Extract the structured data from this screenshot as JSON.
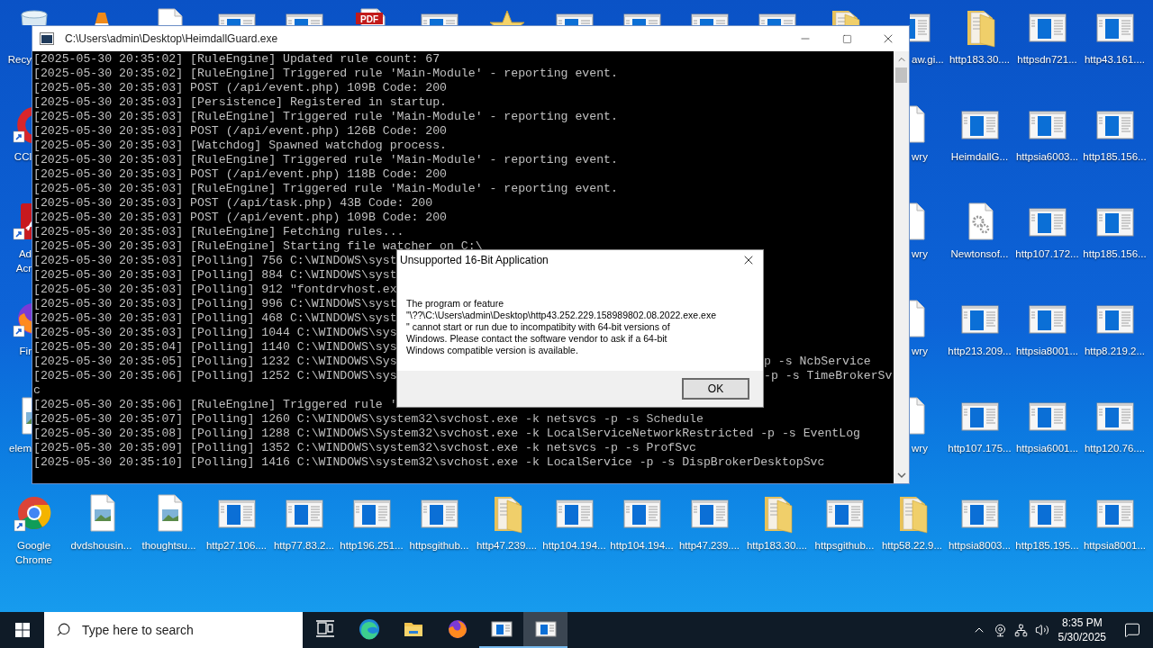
{
  "desktop": {
    "top_row": [
      {
        "kind": "recycle",
        "label": "Recy"
      },
      {
        "kind": "cone"
      },
      {
        "kind": "file"
      },
      {
        "kind": "app"
      },
      {
        "kind": "app"
      },
      {
        "kind": "pdf",
        "badge": "PDF"
      },
      {
        "kind": "app"
      },
      {
        "kind": "star"
      },
      {
        "kind": "app"
      },
      {
        "kind": "app"
      },
      {
        "kind": "app"
      },
      {
        "kind": "app"
      },
      {
        "kind": "folder"
      },
      {
        "kind": "app",
        "label": "aw.gi..."
      },
      {
        "kind": "folder",
        "label": "http183.30...."
      },
      {
        "kind": "app",
        "label": "httpsdn721..."
      },
      {
        "kind": "app",
        "label": "http43.161...."
      }
    ],
    "left_column": [
      {
        "kind": "ccleaner",
        "label": "CCl"
      },
      {
        "kind": "acrobat",
        "label": "Ad\nAcr"
      },
      {
        "kind": "firefox",
        "label": "Fir"
      },
      {
        "kind": "image",
        "label": "elem"
      }
    ],
    "right_block": [
      {
        "kind": "file",
        "label": "wry"
      },
      {
        "kind": "app",
        "label": "HeimdallG..."
      },
      {
        "kind": "app",
        "label": "httpsia6003..."
      },
      {
        "kind": "app",
        "label": "http185.156..."
      },
      {
        "kind": "file",
        "label": "wry"
      },
      {
        "kind": "settings",
        "label": "Newtonsof..."
      },
      {
        "kind": "app",
        "label": "http107.172..."
      },
      {
        "kind": "app",
        "label": "http185.156..."
      },
      {
        "kind": "file",
        "label": "wry"
      },
      {
        "kind": "app",
        "label": "http213.209..."
      },
      {
        "kind": "app",
        "label": "httpsia8001..."
      },
      {
        "kind": "app",
        "label": "http8.219.2..."
      },
      {
        "kind": "file",
        "label": "wry"
      },
      {
        "kind": "app",
        "label": "http107.175..."
      },
      {
        "kind": "app",
        "label": "httpsia6001..."
      },
      {
        "kind": "app",
        "label": "http120.76...."
      }
    ],
    "bottom_row": [
      {
        "kind": "chrome",
        "label": "Google Chrome"
      },
      {
        "kind": "image",
        "label": "dvdshousin..."
      },
      {
        "kind": "image",
        "label": "thoughtsu..."
      },
      {
        "kind": "app",
        "label": "http27.106...."
      },
      {
        "kind": "app",
        "label": "http77.83.2..."
      },
      {
        "kind": "app",
        "label": "http196.251..."
      },
      {
        "kind": "app",
        "label": "httpsgithub..."
      },
      {
        "kind": "folder",
        "label": "http47.239...."
      },
      {
        "kind": "app",
        "label": "http104.194..."
      },
      {
        "kind": "app",
        "label": "http104.194..."
      },
      {
        "kind": "app",
        "label": "http47.239...."
      },
      {
        "kind": "folder",
        "label": "http183.30...."
      },
      {
        "kind": "app",
        "label": "httpsgithub..."
      },
      {
        "kind": "folder",
        "label": "http58.22.9..."
      },
      {
        "kind": "app",
        "label": "httpsia8003..."
      },
      {
        "kind": "app",
        "label": "http185.195..."
      },
      {
        "kind": "app",
        "label": "httpsia8001..."
      }
    ]
  },
  "console": {
    "title": "C:\\Users\\admin\\Desktop\\HeimdallGuard.exe",
    "lines": [
      {
        "text": "[2025-05-30 20:35:02] [RuleEngine] Updated rule count: 67"
      },
      {
        "text": "[2025-05-30 20:35:02] [RuleEngine] Triggered rule 'Main-Module' - reporting event."
      },
      {
        "text": "[2025-05-30 20:35:03] POST (/api/event.php) 109B Code: 200"
      },
      {
        "text": "[2025-05-30 20:35:03] [Persistence] Registered in startup."
      },
      {
        "text": "[2025-05-30 20:35:03] [RuleEngine] Triggered rule 'Main-Module' - reporting event."
      },
      {
        "text": "[2025-05-30 20:35:03] POST (/api/event.php) 126B Code: 200"
      },
      {
        "text": "[2025-05-30 20:35:03] [Watchdog] Spawned watchdog process."
      },
      {
        "text": "[2025-05-30 20:35:03] [RuleEngine] Triggered rule 'Main-Module' - reporting event."
      },
      {
        "text": "[2025-05-30 20:35:03] POST (/api/event.php) 118B Code: 200"
      },
      {
        "text": "[2025-05-30 20:35:03] [RuleEngine] Triggered rule 'Main-Module' - reporting event."
      },
      {
        "text": "[2025-05-30 20:35:03] POST (/api/task.php) 43B Code: 200"
      },
      {
        "text": "[2025-05-30 20:35:03] POST (/api/event.php) 109B Code: 200"
      },
      {
        "text": "[2025-05-30 20:35:03] [RuleEngine] Fetching rules..."
      },
      {
        "text": "[2025-05-30 20:35:03] [RuleEngine] Starting file watcher on C:\\"
      },
      {
        "text": "[2025-05-30 20:35:03] [Polling] 756 C:\\WINDOWS\\syst"
      },
      {
        "text": "[2025-05-30 20:35:03] [Polling] 884 C:\\WINDOWS\\syst"
      },
      {
        "text": "[2025-05-30 20:35:03] [Polling] 912 \"fontdrvhost.ex"
      },
      {
        "text": "[2025-05-30 20:35:03] [Polling] 996 C:\\WINDOWS\\syst"
      },
      {
        "text": "[2025-05-30 20:35:03] [Polling] 468 C:\\WINDOWS\\syst"
      },
      {
        "text": "[2025-05-30 20:35:03] [Polling] 1044 C:\\WINDOWS\\sys"
      },
      {
        "text": "[2025-05-30 20:35:04] [Polling] 1140 C:\\WINDOWS\\sys"
      },
      {
        "text": "[2025-05-30 20:35:05] [Polling] 1232 C:\\WINDOWS\\Sys",
        "tail": "p -s NcbService"
      },
      {
        "text": "[2025-05-30 20:35:06] [Polling] 1252 C:\\WINDOWS\\sys",
        "tail": "-p -s TimeBrokerSv"
      },
      {
        "text": "c"
      },
      {
        "text": "[2025-05-30 20:35:06] [RuleEngine] Triggered rule '"
      },
      {
        "text": "[2025-05-30 20:35:07] [Polling] 1260 C:\\WINDOWS\\system32\\svchost.exe -k netsvcs -p -s Schedule"
      },
      {
        "text": "[2025-05-30 20:35:08] [Polling] 1288 C:\\WINDOWS\\System32\\svchost.exe -k LocalServiceNetworkRestricted -p -s EventLog"
      },
      {
        "text": "[2025-05-30 20:35:09] [Polling] 1352 C:\\WINDOWS\\system32\\svchost.exe -k netsvcs -p -s ProfSvc"
      },
      {
        "text": "[2025-05-30 20:35:10] [Polling] 1416 C:\\WINDOWS\\system32\\svchost.exe -k LocalService -p -s DispBrokerDesktopSvc"
      }
    ]
  },
  "dialog": {
    "title": "Unsupported 16-Bit Application",
    "message": "The program or feature\n\"\\??\\C:\\Users\\admin\\Desktop\\http43.252.229.158989802.08.2022.exe.exe\n\" cannot start or run due to incompatibity with 64-bit versions of\nWindows. Please contact the software vendor to ask if a 64-bit\nWindows compatible version is available.",
    "button": "OK"
  },
  "taskbar": {
    "search_placeholder": "Type here to search",
    "apps": [
      {
        "kind": "taskview",
        "running": false,
        "selected": false
      },
      {
        "kind": "edge",
        "running": false,
        "selected": false
      },
      {
        "kind": "explorer",
        "running": false,
        "selected": false
      },
      {
        "kind": "firefox",
        "running": false,
        "selected": false
      },
      {
        "kind": "window",
        "running": true,
        "selected": false
      },
      {
        "kind": "window",
        "running": true,
        "selected": true
      }
    ],
    "time": "8:35 PM",
    "date": "5/30/2025"
  }
}
